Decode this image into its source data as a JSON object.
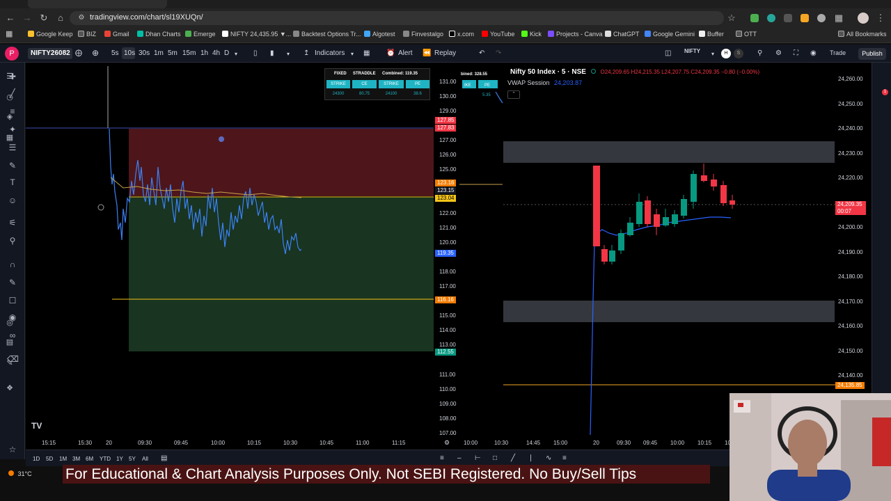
{
  "browser": {
    "url": "tradingview.com/chart/sl19XUQn/",
    "bookmarks": [
      "Google Keep",
      "BIZ",
      "Gmail",
      "Dhan Charts",
      "Emerge",
      "NIFTY 24,435.95 ▼...",
      "Backtest Options Tr...",
      "Algotest",
      "Finvestalgo",
      "x.com",
      "YouTube",
      "Kick",
      "Projects - Canva",
      "ChatGPT",
      "Google Gemini",
      "Buffer",
      "OTT"
    ],
    "all_bookmarks": "All Bookmarks",
    "accent": "#4caf50"
  },
  "toolbar": {
    "symbol": "NIFTY26082",
    "intervals": [
      "5s",
      "10s",
      "30s",
      "1m",
      "5m",
      "15m",
      "1h",
      "4h",
      "D"
    ],
    "active_interval": "10s",
    "indicators": "Indicators",
    "alert": "Alert",
    "replay": "Replay",
    "right_symbol": "NIFTY",
    "trade": "Trade",
    "publish": "Publish"
  },
  "left_chart": {
    "y_labels": [
      "131.00",
      "130.00",
      "129.00",
      "127.00",
      "126.00",
      "125.00",
      "122.00",
      "121.00",
      "120.00",
      "118.00",
      "117.00",
      "115.00",
      "114.00",
      "113.00",
      "111.00",
      "110.00",
      "109.00",
      "108.00",
      "107.00"
    ],
    "x_labels": [
      "15:15",
      "15:30",
      "20",
      "09:30",
      "09:45",
      "10:00",
      "10:15",
      "10:30",
      "10:45",
      "11:00",
      "11:15"
    ],
    "price_tags": [
      {
        "text": "127.85",
        "color": "#f23645"
      },
      {
        "text": "127.83",
        "color": "#f23645"
      },
      {
        "text": "123.16",
        "color": "#f57c00"
      },
      {
        "text": "123.15",
        "color": "#131722"
      },
      {
        "text": "123.04",
        "color": "#f5c518"
      },
      {
        "text": "119.35",
        "color": "#2962ff"
      },
      {
        "text": "116.16",
        "color": "#f57c00"
      },
      {
        "text": "112.55",
        "color": "#089981"
      }
    ],
    "straddle": {
      "fixed": "FIXED",
      "straddle": "STRADDLE",
      "combined": "Combined:  119.35",
      "cols": [
        "STRIKE",
        "CE",
        "STRIKE",
        "PE"
      ],
      "vals": [
        "24300",
        "80.75",
        "24100",
        "38.6"
      ]
    },
    "peek": {
      "combined": "bined:  328.55",
      "cols": [
        "IKE",
        "PE"
      ],
      "vals": [
        "5.35"
      ]
    }
  },
  "right_chart": {
    "title": "Nifty 50 Index · 5 · NSE",
    "ohlc": "O24,209.65  H24,215.35  L24,207.75  C24,209.35  −0.80 (−0.00%)",
    "vwap_label": "VWAP Session",
    "vwap_value": "24,203.87",
    "y_labels": [
      "24,260.00",
      "24,250.00",
      "24,240.00",
      "24,230.00",
      "24,220.00",
      "24,200.00",
      "24,190.00",
      "24,180.00",
      "24,170.00",
      "24,160.00",
      "24,150.00",
      "24,140.00"
    ],
    "x_labels": [
      "10:00",
      "10:30",
      "14:45",
      "15:00",
      "20",
      "09:30",
      "09:45",
      "10:00",
      "10:15",
      "10"
    ],
    "last_price": "24,209.35",
    "countdown": "00:07",
    "support_tag": "24,135.85"
  },
  "bottom": {
    "ranges": [
      "1D",
      "5D",
      "1M",
      "3M",
      "6M",
      "YTD",
      "1Y",
      "5Y",
      "All"
    ],
    "weather": "31°C",
    "disclaimer": "For Educational & Chart Analysis Purposes Only. Not SEBI Registered. No Buy/Sell Tips"
  }
}
